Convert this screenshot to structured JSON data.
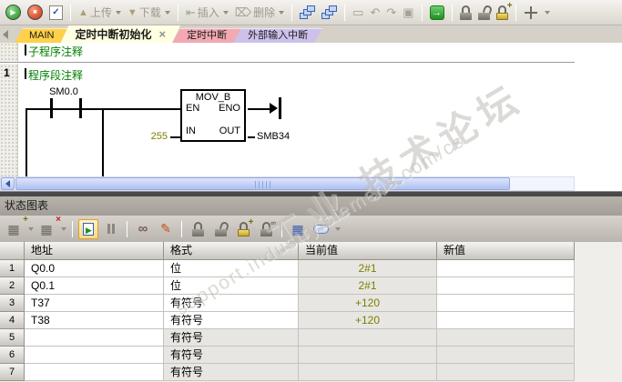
{
  "main_toolbar": {
    "upload_label": "上传",
    "download_label": "下载",
    "insert_label": "插入",
    "delete_label": "删除"
  },
  "icons": {
    "run": "▶",
    "stop": "■",
    "compile": "✓",
    "up_arrow": "▲",
    "down_arrow": "▼",
    "insert": "⇤",
    "delete": "⌦",
    "window_blank": "▭",
    "undo": "↶",
    "redo": "↷",
    "bookmark": "▣",
    "goto": "→",
    "close": "×",
    "grid": "▦",
    "plus": "+",
    "cross": "×",
    "play_small": "▶",
    "binoculars": "∞",
    "pencil": "✎",
    "rings": "∞"
  },
  "tabs": [
    {
      "label": "MAIN",
      "color": "#FFD04A"
    },
    {
      "label": "定时中断初始化",
      "color": "#FFFFE2"
    },
    {
      "label": "定时中断",
      "color": "#F2A9B2"
    },
    {
      "label": "外部输入中断",
      "color": "#CDC1EB"
    }
  ],
  "ladder": {
    "subroutine_comment": "子程序注释",
    "network_number": "1",
    "network_comment": "程序段注释",
    "contact_label": "SM0.0",
    "block_title": "MOV_B",
    "pin_en": "EN",
    "pin_eno": "ENO",
    "pin_in": "IN",
    "pin_out": "OUT",
    "in_value": "255",
    "out_operand": "SMB34"
  },
  "status_panel": {
    "title": "状态图表",
    "table": {
      "headers": [
        "地址",
        "格式",
        "当前值",
        "新值"
      ],
      "rows": [
        {
          "num": "1",
          "address": "Q0.0",
          "format": "位",
          "current": "2#1",
          "new_value": ""
        },
        {
          "num": "2",
          "address": "Q0.1",
          "format": "位",
          "current": "2#1",
          "new_value": ""
        },
        {
          "num": "3",
          "address": "T37",
          "format": "有符号",
          "current": "+120",
          "new_value": ""
        },
        {
          "num": "4",
          "address": "T38",
          "format": "有符号",
          "current": "+120",
          "new_value": ""
        },
        {
          "num": "5",
          "address": "",
          "format": "有符号",
          "current": "",
          "new_value": ""
        },
        {
          "num": "6",
          "address": "",
          "format": "有符号",
          "current": "",
          "new_value": ""
        },
        {
          "num": "7",
          "address": "",
          "format": "有符号",
          "current": "",
          "new_value": ""
        }
      ]
    }
  },
  "watermark": {
    "line1": "工业 技术论坛",
    "line2": "support.industry.siemens.com/cs"
  },
  "colors": {
    "comment_green": "#008000",
    "value_olive": "#7E7E00",
    "active_tab": "#FFFFE2",
    "tab_main": "#FFD04A",
    "tab_pink": "#F2A9B2",
    "tab_lavender": "#CDC1EB",
    "scrollbar_thumb": "#BCCAF5",
    "splitter": "#494949"
  }
}
